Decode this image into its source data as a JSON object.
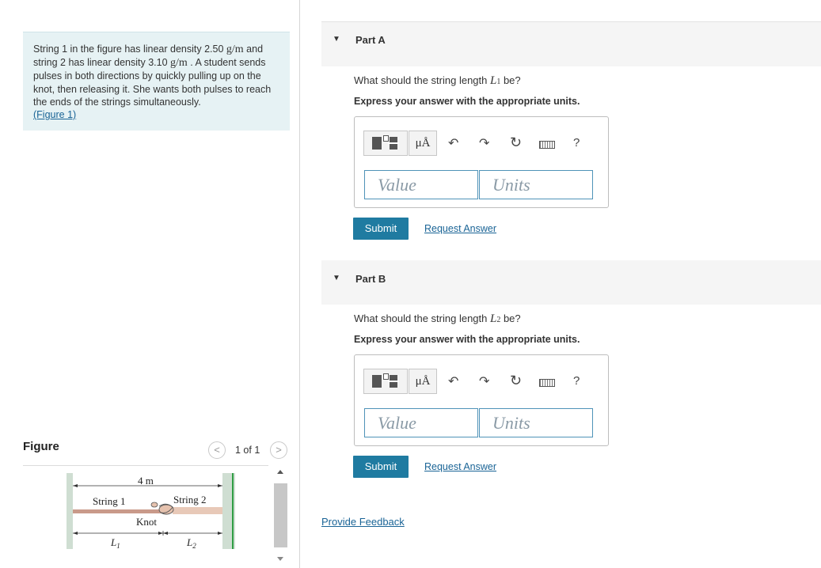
{
  "problem": {
    "text_1": "String 1 in the figure has linear density 2.50 ",
    "unit_1": "g/m",
    "text_2": " and string 2 has linear density 3.10 ",
    "unit_2": "g/m",
    "text_3": " . A student sends pulses in both directions by quickly pulling up on the knot, then releasing it. She wants both pulses to reach the ends of the strings simultaneously.",
    "figure_link": "(Figure 1)"
  },
  "figure": {
    "title": "Figure",
    "counter": "1 of 1",
    "prev": "<",
    "next": ">",
    "labels": {
      "distance": "4 m",
      "string1": "String 1",
      "string2": "String 2",
      "knot": "Knot",
      "l1": "L",
      "l1_sub": "1",
      "l2": "L",
      "l2_sub": "2"
    }
  },
  "parts": [
    {
      "label": "Part A",
      "question_pre": "What should the string length ",
      "var": "L",
      "var_sub": "1",
      "question_post": " be?",
      "instruction": "Express your answer with the appropriate units.",
      "value_placeholder": "Value",
      "units_placeholder": "Units",
      "submit": "Submit",
      "request": "Request Answer"
    },
    {
      "label": "Part B",
      "question_pre": "What should the string length ",
      "var": "L",
      "var_sub": "2",
      "question_post": " be?",
      "instruction": "Express your answer with the appropriate units.",
      "value_placeholder": "Value",
      "units_placeholder": "Units",
      "submit": "Submit",
      "request": "Request Answer"
    }
  ],
  "toolbar": {
    "mu_label": "μÅ",
    "help": "?"
  },
  "feedback": "Provide Feedback",
  "colors": {
    "accent": "#1f7ba1",
    "link": "#1a6496",
    "problem_bg": "#e6f2f4",
    "string1": "#c99a8a",
    "string2": "#e8c9b8"
  }
}
